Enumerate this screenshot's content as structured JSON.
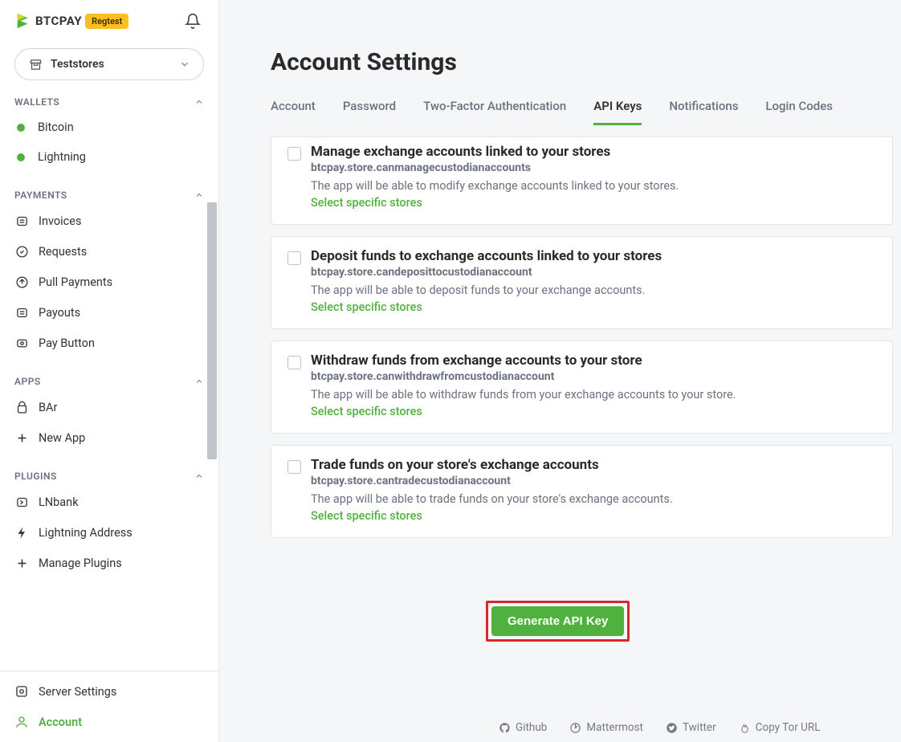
{
  "brand": {
    "name": "BTCPAY",
    "badge": "Regtest"
  },
  "store_selector": {
    "name": "Teststores"
  },
  "sidebar": {
    "wallets_label": "WALLETS",
    "wallets": [
      {
        "label": "Bitcoin"
      },
      {
        "label": "Lightning"
      }
    ],
    "payments_label": "PAYMENTS",
    "payments": [
      {
        "label": "Invoices"
      },
      {
        "label": "Requests"
      },
      {
        "label": "Pull Payments"
      },
      {
        "label": "Payouts"
      },
      {
        "label": "Pay Button"
      }
    ],
    "apps_label": "APPS",
    "apps": [
      {
        "label": "BAr"
      },
      {
        "label": "New App"
      }
    ],
    "plugins_label": "PLUGINS",
    "plugins": [
      {
        "label": "LNbank"
      },
      {
        "label": "Lightning Address"
      },
      {
        "label": "Manage Plugins"
      }
    ],
    "bottom": [
      {
        "label": "Server Settings"
      },
      {
        "label": "Account"
      }
    ]
  },
  "page": {
    "title": "Account Settings"
  },
  "tabs": [
    {
      "label": "Account"
    },
    {
      "label": "Password"
    },
    {
      "label": "Two-Factor Authentication"
    },
    {
      "label": "API Keys"
    },
    {
      "label": "Notifications"
    },
    {
      "label": "Login Codes"
    }
  ],
  "permissions": [
    {
      "title": "Manage exchange accounts linked to your stores",
      "key": "btcpay.store.canmanagecustodianaccounts",
      "desc": "The app will be able to modify exchange accounts linked to your stores.",
      "link": "Select specific stores"
    },
    {
      "title": "Deposit funds to exchange accounts linked to your stores",
      "key": "btcpay.store.candeposittocustodianaccount",
      "desc": "The app will be able to deposit funds to your exchange accounts.",
      "link": "Select specific stores"
    },
    {
      "title": "Withdraw funds from exchange accounts to your store",
      "key": "btcpay.store.canwithdrawfromcustodianaccount",
      "desc": "The app will be able to withdraw funds from your exchange accounts to your store.",
      "link": "Select specific stores"
    },
    {
      "title": "Trade funds on your store's exchange accounts",
      "key": "btcpay.store.cantradecustodianaccount",
      "desc": "The app will be able to trade funds on your store's exchange accounts.",
      "link": "Select specific stores"
    }
  ],
  "buttons": {
    "generate": "Generate API Key"
  },
  "footer": [
    {
      "label": "Github"
    },
    {
      "label": "Mattermost"
    },
    {
      "label": "Twitter"
    },
    {
      "label": "Copy Tor URL"
    }
  ]
}
